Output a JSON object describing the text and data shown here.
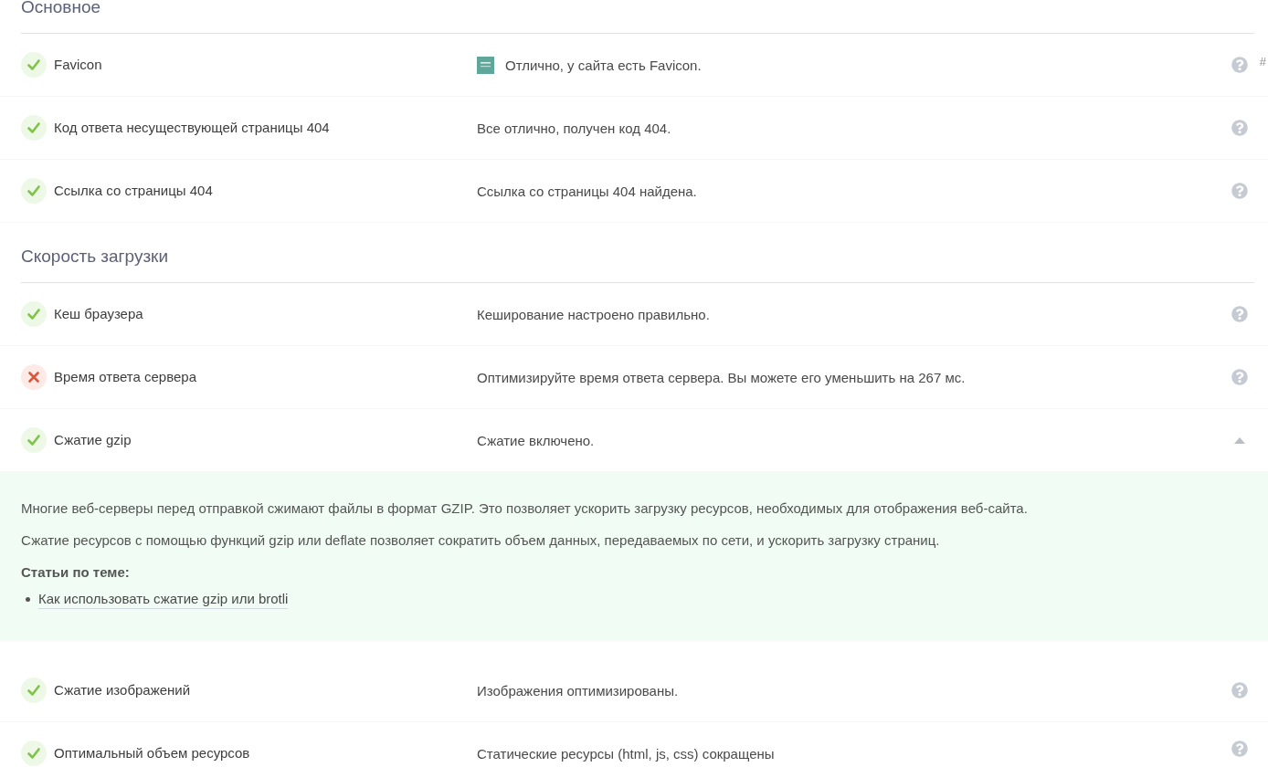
{
  "sections": [
    {
      "title": "Основное",
      "checks": [
        {
          "passed": true,
          "name": "Favicon",
          "result": "Отлично, у сайта есть Favicon.",
          "favicon_preview": true,
          "expanded": false,
          "anchor": "#"
        },
        {
          "passed": true,
          "name": "Код ответа несуществующей страницы 404",
          "result": "Все отлично, получен код 404.",
          "expanded": false
        },
        {
          "passed": true,
          "name": "Ссылка со страницы 404",
          "result": "Ссылка со страницы 404 найдена.",
          "expanded": false
        }
      ]
    },
    {
      "title": "Скорость загрузки",
      "checks": [
        {
          "passed": true,
          "name": "Кеш браузера",
          "result": "Кеширование настроено правильно.",
          "expanded": false
        },
        {
          "passed": false,
          "name": "Время ответа сервера",
          "result": "Оптимизируйте время ответа сервера. Вы можете его уменьшить на 267 мс.",
          "expanded": false
        },
        {
          "passed": true,
          "name": "Сжатие gzip",
          "result": "Сжатие включено.",
          "expanded": true,
          "details": {
            "paragraphs": [
              "Многие веб-серверы перед отправкой сжимают файлы в формат GZIP. Это позволяет ускорить загрузку ресурсов, необходимых для отображения веб-сайта.",
              "Сжатие ресурсов с помощью функций gzip или deflate позволяет сократить объем данных, передаваемых по сети, и ускорить загрузку страниц."
            ],
            "articles_heading": "Статьи по теме:",
            "articles": [
              "Как использовать сжатие gzip или brotli"
            ]
          }
        },
        {
          "passed": true,
          "name": "Сжатие изображений",
          "result": "Изображения оптимизированы.",
          "expanded": false
        },
        {
          "passed": true,
          "name": "Оптимальный объем ресурсов",
          "result": "Статические ресурсы (html, js, css) сокращены",
          "expanded": false
        }
      ]
    }
  ]
}
